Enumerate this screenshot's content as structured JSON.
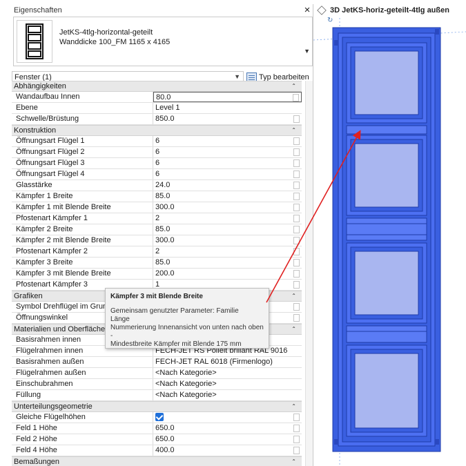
{
  "panel": {
    "title": "Eigenschaften",
    "type_line1": "JetKS-4tlg-horizontal-geteilt",
    "type_line2": "Wanddicke 100_FM 1165 x 4165",
    "instance_selector": "Fenster (1)",
    "edit_type_label": "Typ bearbeiten"
  },
  "sections": {
    "abhaengigkeiten": {
      "title": "Abhängigkeiten",
      "rows": [
        {
          "label": "Wandaufbau Innen",
          "value": "80.0"
        },
        {
          "label": "Ebene",
          "value": "Level 1"
        },
        {
          "label": "Schwelle/Brüstung",
          "value": "850.0"
        }
      ]
    },
    "konstruktion": {
      "title": "Konstruktion",
      "rows": [
        {
          "label": "Öffnungsart Flügel 1",
          "value": "6"
        },
        {
          "label": "Öffnungsart Flügel 2",
          "value": "6"
        },
        {
          "label": "Öffnungsart Flügel 3",
          "value": "6"
        },
        {
          "label": "Öffnungsart Flügel 4",
          "value": "6"
        },
        {
          "label": "Glasstärke",
          "value": "24.0"
        },
        {
          "label": "Kämpfer 1 Breite",
          "value": "85.0"
        },
        {
          "label": "Kämpfer 1 mit Blende Breite",
          "value": "300.0"
        },
        {
          "label": "Pfostenart Kämpfer 1",
          "value": "2"
        },
        {
          "label": "Kämpfer 2 Breite",
          "value": "85.0"
        },
        {
          "label": "Kämpfer 2 mit Blende Breite",
          "value": "300.0"
        },
        {
          "label": "Pfostenart Kämpfer 2",
          "value": "2"
        },
        {
          "label": "Kämpfer 3 Breite",
          "value": "85.0"
        },
        {
          "label": "Kämpfer 3 mit Blende Breite",
          "value": "200.0"
        },
        {
          "label": "Pfostenart Kämpfer 3",
          "value": "1"
        }
      ]
    },
    "grafiken": {
      "title": "Grafiken",
      "rows": [
        {
          "label": "Symbol Drehflügel im Grun",
          "value": ""
        },
        {
          "label": "Öffnungswinkel",
          "value": ""
        }
      ]
    },
    "materialien": {
      "title": "Materialien und Oberflächen",
      "rows": [
        {
          "label": "Basisrahmen innen",
          "value": ""
        },
        {
          "label": "Flügelrahmen innen",
          "value": "FECH-JET RS Polleit brillant RAL 9016"
        },
        {
          "label": "Basisrahmen außen",
          "value": "FECH-JET RAL 6018 (Firmenlogo)"
        },
        {
          "label": "Flügelrahmen außen",
          "value": "<Nach Kategorie>"
        },
        {
          "label": "Einschubrahmen",
          "value": "<Nach Kategorie>"
        },
        {
          "label": "Füllung",
          "value": "<Nach Kategorie>"
        }
      ]
    },
    "unterteilung": {
      "title": "Unterteilungsgeometrie",
      "rows": [
        {
          "label": "Gleiche Flügelhöhen",
          "value": ""
        },
        {
          "label": "Feld 1 Höhe",
          "value": "650.0"
        },
        {
          "label": "Feld 2 Höhe",
          "value": "650.0"
        },
        {
          "label": "Feld 4 Höhe",
          "value": "400.0"
        }
      ]
    },
    "bemassungen": {
      "title": "Bemaßungen"
    }
  },
  "tooltip": {
    "title": "Kämpfer 3 mit Blende Breite",
    "line1": "Gemeinsam genutzter Parameter: Familie",
    "line2": "Länge",
    "line3": "Nummerierung Innenansicht von unten nach oben -",
    "line4": "Mindestbreite Kämpfer mit Blende 175 mm"
  },
  "view": {
    "title": "3D JetKS-horiz-geteilt-4tlg außen"
  },
  "colors": {
    "frame_blue": "#3a5fe0",
    "glass_blue": "#a9b6f0",
    "annotation_red": "#e02020"
  }
}
